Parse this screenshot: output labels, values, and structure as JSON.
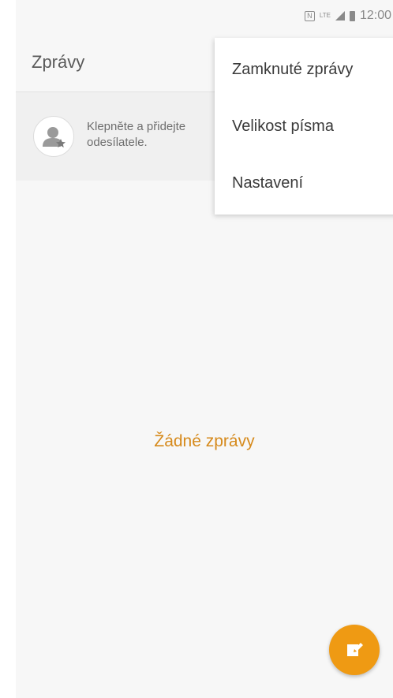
{
  "status_bar": {
    "nfc_icon": "N",
    "network_type": "LTE",
    "time": "12:00"
  },
  "app_bar": {
    "title": "Zprávy"
  },
  "banner": {
    "text": "Klepněte a přidejte\nodesílatele."
  },
  "empty_state": {
    "text": "Žádné zprávy"
  },
  "menu": {
    "items": [
      {
        "label": "Zamknuté zprávy"
      },
      {
        "label": "Velikost písma"
      },
      {
        "label": "Nastavení"
      }
    ]
  },
  "colors": {
    "accent": "#ef9a13",
    "empty_text": "#d68a1c"
  },
  "icons": {
    "fab": "compose-icon",
    "banner": "add-priority-sender-icon"
  }
}
